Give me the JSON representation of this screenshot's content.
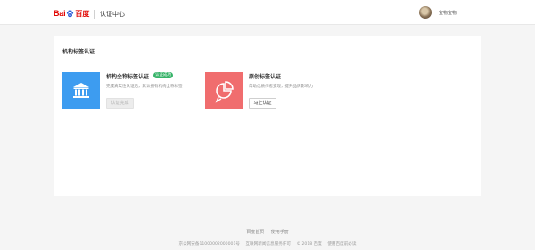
{
  "header": {
    "logo_text_latin": "Bai",
    "logo_text_cn": "百度",
    "site_title": "认证中心",
    "user_name": "宝物宝物"
  },
  "section": {
    "title": "机构标签认证"
  },
  "cards": [
    {
      "title": "机构全称标签认证",
      "badge": "认证成功",
      "description": "完成真实性认证后，默认拥有机构全称标签",
      "button": "认证完成",
      "icon": "bank-icon",
      "color": "#3d9cf0"
    },
    {
      "title": "原创标签认证",
      "description": "帮助优质作者变现，提升品牌影响力",
      "button": "马上认证",
      "icon": "pie-chart-icon",
      "color": "#f06d6e"
    }
  ],
  "footer": {
    "links": [
      "百度首页",
      "使用手册"
    ],
    "legal": [
      "京公网安备11000002000001号",
      "互联网新闻信息服务许可",
      "© 2018 百度",
      "使用百度前必读"
    ]
  }
}
